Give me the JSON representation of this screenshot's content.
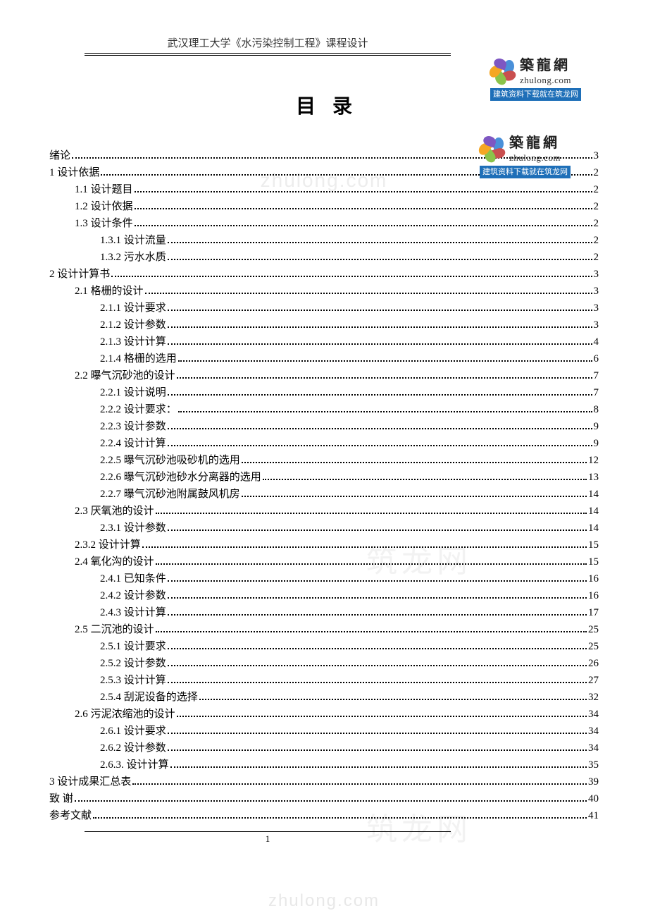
{
  "header": {
    "text": "武汉理工大学《水污染控制工程》课程设计"
  },
  "logo": {
    "cn": "築龍網",
    "en": "zhulong.com",
    "tagline": "建筑资料下载就在筑龙网"
  },
  "title": "目录",
  "watermark": "zhulong.com",
  "faint_watermark": "筑龙网",
  "page_number": "1",
  "toc": [
    {
      "label": "绪论",
      "page": "3",
      "indent": 0
    },
    {
      "label": "1 设计依据",
      "page": "2",
      "indent": 0
    },
    {
      "label": "1.1 设计题目",
      "page": "2",
      "indent": 1
    },
    {
      "label": "1.2 设计依据",
      "page": "2",
      "indent": 1
    },
    {
      "label": "1.3 设计条件",
      "page": "2",
      "indent": 1
    },
    {
      "label": "1.3.1 设计流量",
      "page": "2",
      "indent": 2
    },
    {
      "label": "1.3.2 污水水质",
      "page": "2",
      "indent": 2
    },
    {
      "label": "2 设计计算书",
      "page": "3",
      "indent": 0
    },
    {
      "label": "2.1 格栅的设计",
      "page": "3",
      "indent": 1
    },
    {
      "label": "2.1.1 设计要求",
      "page": "3",
      "indent": 2
    },
    {
      "label": "2.1.2 设计参数",
      "page": "3",
      "indent": 2
    },
    {
      "label": "2.1.3 设计计算",
      "page": "4",
      "indent": 2
    },
    {
      "label": "2.1.4 格栅的选用",
      "page": "6",
      "indent": 2
    },
    {
      "label": "2.2 曝气沉砂池的设计",
      "page": "7",
      "indent": 1
    },
    {
      "label": "2.2.1 设计说明",
      "page": "7",
      "indent": 2
    },
    {
      "label": "2.2.2 设计要求：",
      "page": "8",
      "indent": 2
    },
    {
      "label": "2.2.3 设计参数",
      "page": "9",
      "indent": 2
    },
    {
      "label": "2.2.4 设计计算",
      "page": "9",
      "indent": 2
    },
    {
      "label": "2.2.5 曝气沉砂池吸砂机的选用",
      "page": "12",
      "indent": 2
    },
    {
      "label": "2.2.6 曝气沉砂池砂水分离器的选用",
      "page": "13",
      "indent": 2
    },
    {
      "label": "2.2.7 曝气沉砂池附属鼓风机房",
      "page": "14",
      "indent": 2
    },
    {
      "label": "2.3 厌氧池的设计",
      "page": "14",
      "indent": 1
    },
    {
      "label": "2.3.1 设计参数",
      "page": "14",
      "indent": 2
    },
    {
      "label": "2.3.2 设计计算",
      "page": "15",
      "indent": 1
    },
    {
      "label": "2.4 氧化沟的设计",
      "page": "15",
      "indent": 1
    },
    {
      "label": "2.4.1 已知条件",
      "page": "16",
      "indent": 2
    },
    {
      "label": "2.4.2 设计参数",
      "page": "16",
      "indent": 2
    },
    {
      "label": "2.4.3 设计计算",
      "page": "17",
      "indent": 2
    },
    {
      "label": "2.5 二沉池的设计",
      "page": "25",
      "indent": 1
    },
    {
      "label": "2.5.1  设计要求",
      "page": "25",
      "indent": 2
    },
    {
      "label": "2.5.2 设计参数",
      "page": "26",
      "indent": 2
    },
    {
      "label": "2.5.3 设计计算",
      "page": "27",
      "indent": 2
    },
    {
      "label": "2.5.4 刮泥设备的选择",
      "page": "32",
      "indent": 2
    },
    {
      "label": "2.6  污泥浓缩池的设计",
      "page": "34",
      "indent": 1
    },
    {
      "label": "2.6.1 设计要求",
      "page": "34",
      "indent": 2
    },
    {
      "label": "2.6.2 设计参数",
      "page": "34",
      "indent": 2
    },
    {
      "label": "2.6.3.  设计计算",
      "page": "35",
      "indent": 2
    },
    {
      "label": "3 设计成果汇总表",
      "page": "39",
      "indent": 0
    },
    {
      "label": "致  谢",
      "page": "40",
      "indent": 0
    },
    {
      "label": "参考文献",
      "page": "41",
      "indent": 0
    }
  ]
}
